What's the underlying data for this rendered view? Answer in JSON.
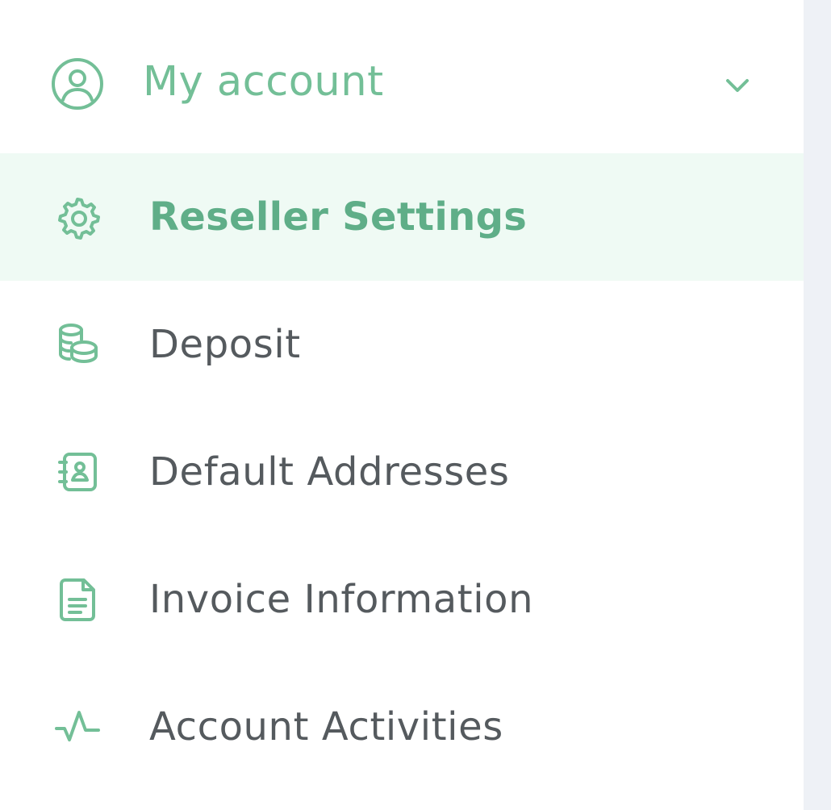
{
  "colors": {
    "accent": "#73bf97",
    "active_background": "#effaf4",
    "text": "#555a5e",
    "sidebar_background": "#ffffff",
    "page_background": "#eef1f6"
  },
  "header": {
    "label": "My account",
    "icon": "user-circle-icon",
    "toggle_icon": "chevron-down-icon"
  },
  "menu": {
    "items": [
      {
        "label": "Reseller Settings",
        "icon": "gear-icon",
        "active": true
      },
      {
        "label": "Deposit",
        "icon": "coins-stack-icon",
        "active": false
      },
      {
        "label": "Default Addresses",
        "icon": "address-book-icon",
        "active": false
      },
      {
        "label": "Invoice Information",
        "icon": "document-icon",
        "active": false
      },
      {
        "label": "Account Activities",
        "icon": "activity-pulse-icon",
        "active": false
      }
    ]
  }
}
